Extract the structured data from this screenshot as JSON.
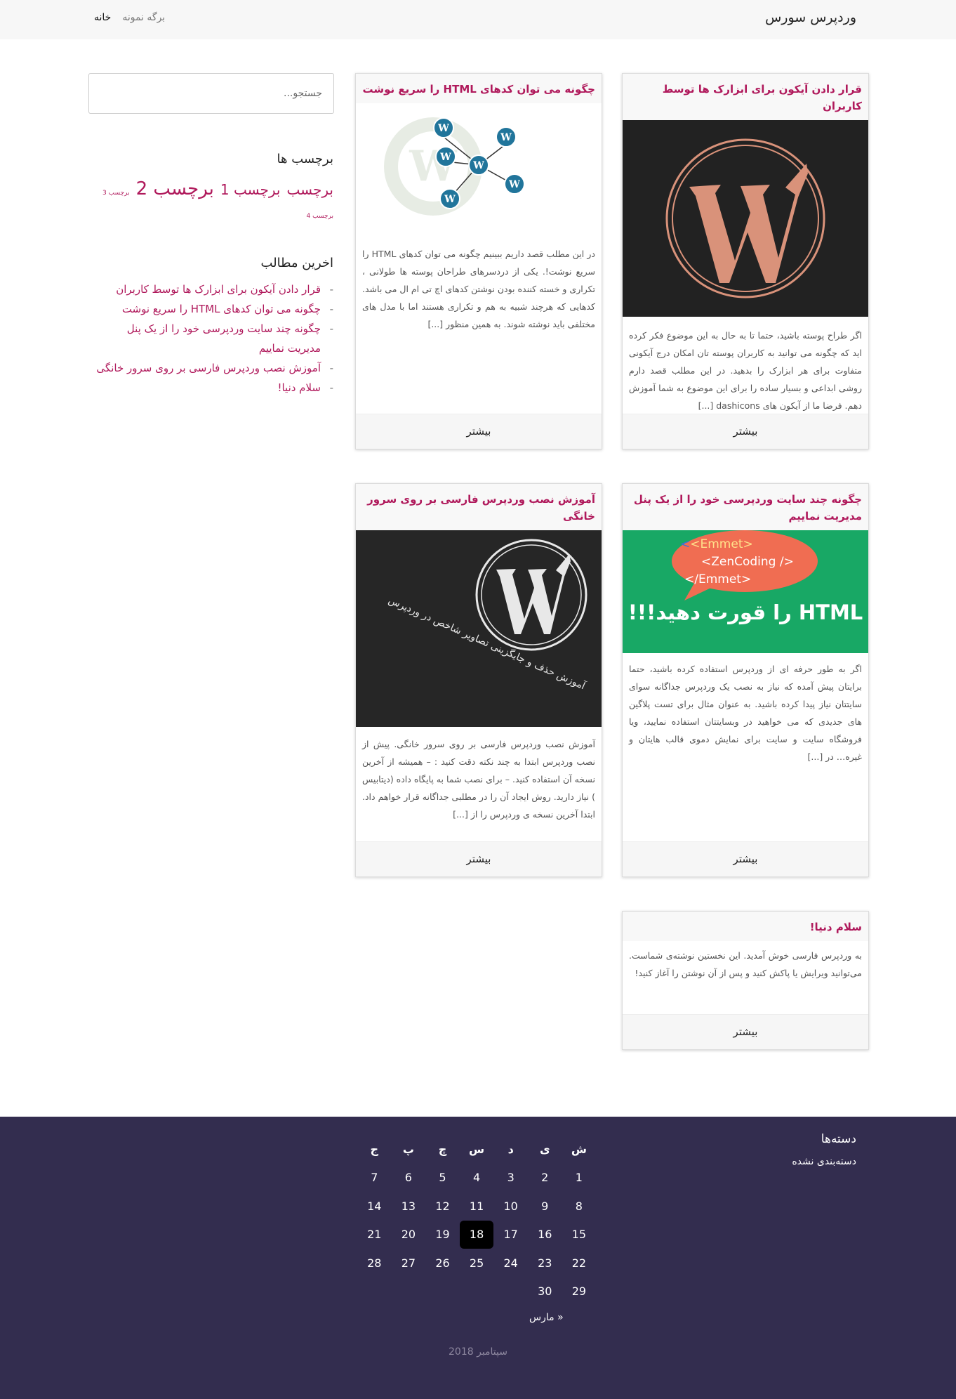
{
  "header": {
    "brand": "وردپرس سورس",
    "nav": [
      "خانه",
      "برگه نمونه"
    ]
  },
  "posts": [
    {
      "title": "قرار دادن آیکون برای ابزارک ها توسط کاربران",
      "excerpt": "اگر طراح پوسته باشید، حتما تا به حال به این موضوع فکر کرده اید که چگونه می توانید به کاربران پوسته تان امکان درج آیکونی متفاوت برای هر ابزارک را بدهید. در این مطلب قصد دارم روشی ابداعی و بسیار ساده را برای این موضوع به شما آموزش دهم. فرضا ما از آیکون های dashicons [...]",
      "more": "بیشتر",
      "image": "wordpress-logo-peach-on-dark"
    },
    {
      "title": "چگونه می توان کدهای HTML را سریع نوشت",
      "excerpt": "در این مطلب قصد داریم ببینیم چگونه می توان کدهای HTML را سریع نوشت!. یکی از دردسرهای طراحان پوسته ها طولانی ، تکراری و خسته کننده بودن نوشتن کدهای اچ تی ام ال می باشد. کدهایی که هرچند شبیه به هم و تکراری هستند اما با مدل های مختلفی باید نوشته شوند. به همین منظور [...]",
      "more": "بیشتر",
      "image": "wordpress-network-diagram"
    },
    {
      "title": "چگونه چند سایت وردپرسی خود را از یک پنل مدیریت نمایيم",
      "excerpt": "اگر به طور حرفه ای از وردپرس استفاده کرده باشید، حتما برایتان پیش آمده که نیاز به نصب یک وردپرس جداگانه سوای سایتتان نیاز پیدا کرده باشید. به عنوان مثال برای تست پلاگین های جدیدی که می خواهید در وبسایتتان استفاده نمایید، ویا فروشگاه سایت و سایت برای نمایش دموی قالب هایتان و غیره… در [...]",
      "more": "بیشتر",
      "image": {
        "bubble": [
          "<Emmet>",
          "<ZenCoding />",
          "</Emmet>"
        ],
        "caption": "HTML را قورت دهید!!!"
      }
    },
    {
      "title": "آموزش نصب وردپرس فارسی بر روی سرور خانگی",
      "excerpt": "آموزش نصب وردپرس فارسی بر روی سرور خانگی. پیش از نصب وردپرس ابتدا به چند نکته دقت کنید : – همیشه از آخرین نسخه آن استفاده کنید. – برای نصب شما به پایگاه داده (دیتابیس ) نیاز دارید. روش ایجاد آن را در مطلبی جداگانه قرار خواهم داد. ابتدا آخرین نسخه ی وردپرس را از [...]",
      "more": "بیشتر",
      "image": {
        "caption": "آموزش حذف و جایگزینی تصاویر شاخص در وردپرس"
      }
    },
    {
      "title": "سلام دنیا!",
      "excerpt": "به وردپرس فارسی خوش آمدید. این نخستین نوشته‌ی شماست. می‌توانید ویرایش یا پاکش کنید و پس از آن نوشتن را آغاز کنید!",
      "more": "بیشتر"
    }
  ],
  "sidebar": {
    "search_placeholder": "جستجو...",
    "tags_title": "برچسب ها",
    "tags": [
      {
        "label": "برچسب",
        "size": "large"
      },
      {
        "label": "برچسب 1",
        "size": "large"
      },
      {
        "label": "برچسب 2",
        "size": "xlarge"
      },
      {
        "label": "برچسب 3",
        "size": "small"
      },
      {
        "label": "برچسب 4",
        "size": "small"
      }
    ],
    "recent_title": "اخرین مطالب",
    "recent": [
      "قرار دادن آیکون برای ابزارک ها توسط کاربران",
      "چگونه می توان کدهای HTML را سریع نوشت",
      "چگونه چند سایت وردپرسی خود را از یک پنل مدیریت نمایيم",
      "آموزش نصب وردپرس فارسی بر روی سرور خانگی",
      "سلام دنیا!"
    ]
  },
  "footer": {
    "categories_title": "دسته‌ها",
    "categories": [
      "دسته‌بندی نشده"
    ],
    "calendar": {
      "days": [
        "ش",
        "ی",
        "د",
        "س",
        "چ",
        "پ",
        "ج"
      ],
      "weeks": [
        [
          "1",
          "2",
          "3",
          "4",
          "5",
          "6",
          "7"
        ],
        [
          "8",
          "9",
          "10",
          "11",
          "12",
          "13",
          "14"
        ],
        [
          "15",
          "16",
          "17",
          "18",
          "19",
          "20",
          "21"
        ],
        [
          "22",
          "23",
          "24",
          "25",
          "26",
          "27",
          "28"
        ],
        [
          "29",
          "30",
          "",
          "",
          "",
          "",
          ""
        ]
      ],
      "today": "18",
      "prev": "« مارس",
      "caption": "سپتامبر 2018"
    }
  },
  "colors": {
    "accent": "#b01a5c",
    "footer_bg": "#332d4f",
    "navbar_bg": "#f7f7f7",
    "emmet_green": "#18a865",
    "emmet_bubble": "#f06d52"
  }
}
